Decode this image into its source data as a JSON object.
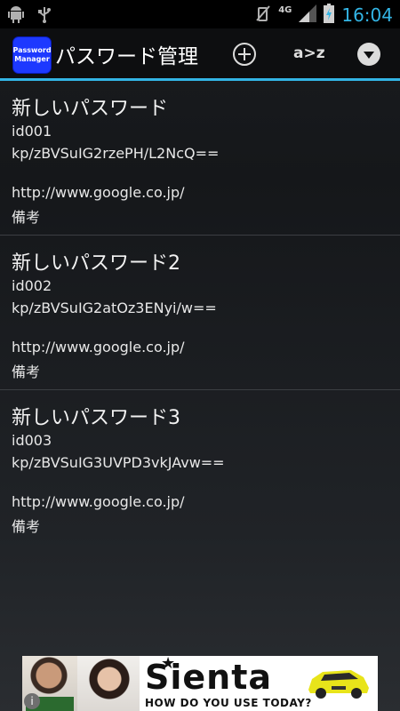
{
  "status_bar": {
    "time": "16:04",
    "network": "4G",
    "icons": [
      "android-debug-icon",
      "usb-icon",
      "mute-icon",
      "signal-icon",
      "battery-charging-icon"
    ],
    "time_color": "#33b5e5"
  },
  "action_bar": {
    "app_icon_text": [
      "Password",
      "Manager"
    ],
    "title": "パスワード管理",
    "sort_label": "a>z",
    "actions": [
      "add-circle-icon",
      "sort-az-icon",
      "dropdown-menu-icon"
    ],
    "accent_color": "#33b5e5",
    "app_icon_color": "#1d39ff"
  },
  "entries": [
    {
      "title": "新しいパスワード",
      "id": "id001",
      "password": "kp/zBVSuIG2rzePH/L2NcQ==",
      "url": "http://www.google.co.jp/",
      "note": "備考"
    },
    {
      "title": "新しいパスワード2",
      "id": "id002",
      "password": "kp/zBVSuIG2atOz3ENyi/w==",
      "url": "http://www.google.co.jp/",
      "note": "備考"
    },
    {
      "title": "新しいパスワード3",
      "id": "id003",
      "password": "kp/zBVSuIG3UVPD3vkJAvw==",
      "url": "http://www.google.co.jp/",
      "note": "備考"
    }
  ],
  "ad": {
    "brand": "Sienta",
    "tagline": "HOW DO YOU USE TODAY?",
    "info_label": "i"
  }
}
